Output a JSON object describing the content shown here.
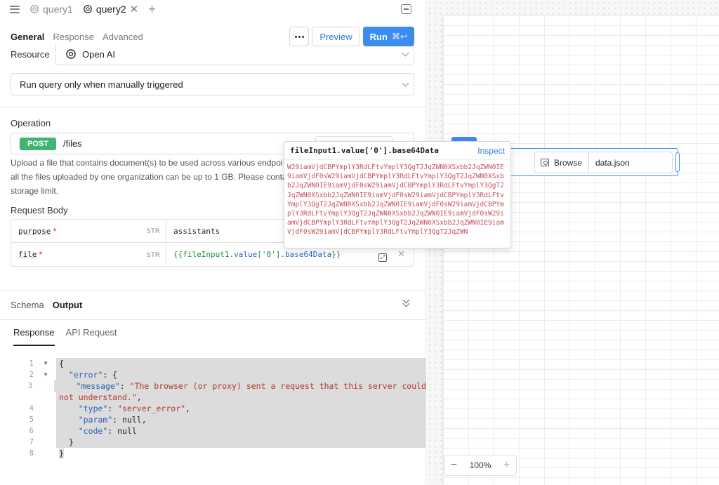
{
  "tabs": {
    "items": [
      {
        "label": "query1",
        "active": false
      },
      {
        "label": "query2",
        "active": true
      }
    ]
  },
  "toolbar": {
    "tabs": [
      "General",
      "Response",
      "Advanced"
    ],
    "preview_label": "Preview",
    "run_label": "Run",
    "run_shortcut": "⌘↩"
  },
  "resource": {
    "label": "Resource",
    "value": "Open AI"
  },
  "trigger": {
    "value": "Run query only when manually triggered"
  },
  "operation": {
    "label": "Operation",
    "method": "POST",
    "path": "/files",
    "description_lines": [
      "Upload a file that contains document(s) to be used across various endpoi",
      "all the files uploaded by one organization can be up to 1 GB. Please conta",
      "storage limit."
    ]
  },
  "request_body": {
    "label": "Request Body",
    "rows": [
      {
        "key": "purpose",
        "type": "STR",
        "value": "assistants"
      },
      {
        "key": "file",
        "type": "STR",
        "value_prefix": "{{fileInput1.",
        "value_prop": "value",
        "value_mid": "['0'].",
        "value_prop2": "base64Data",
        "value_suffix": "}}"
      }
    ]
  },
  "schema_bar": {
    "schema_label": "Schema",
    "output_label": "Output"
  },
  "response_tabs": [
    "Response",
    "API Request"
  ],
  "code_lines": [
    "1",
    "2",
    "3",
    "4",
    "5",
    "6",
    "7",
    "8"
  ],
  "response_json": {
    "error_key": "\"error\"",
    "message_key": "\"message\"",
    "message_val_1": "\"The browser (or proxy) sent a request that this server could",
    "message_val_2": "not understand.\"",
    "type_key": "\"type\"",
    "type_val": "\"server_error\"",
    "param_key": "\"param\"",
    "param_val": "null",
    "code_key": "\"code\"",
    "code_val": "null"
  },
  "popover": {
    "expression": "fileInput1.value['0'].base64Data",
    "inspect_label": "Inspect",
    "value_preview": "W29iamVjdCBPYmplY3RdLFtvYmplY3QgT2JqZWN0XSxbb2JqZWN0IE9iamVjdF0sW29iamVjdCBPYmplY3RdLFtvYmplY3QgT2JqZWN0XSxbb2JqZWN0IE9iamVjdF0sW29iamVjdCBPYmplY3RdLFtvYmplY3QgT2JqZWN0XSxbb2JqZWN0IE9iamVjdF0sW29iamVjdCBPYmplY3RdLFtvYmplY3QgT2JqZWN0XSxbb2JqZWN0IE9iamVjdF0sW29iamVjdCBPYmplY3RdLFtvYmplY3QgT2JqZWN0XSxbb2JqZWN0IE9iamVjdF0sW29iamVjdCBPYmplY3RdLFtvYmplY3QgT2JqZWN0XSxbb2JqZWN0IE9iamVjdF0sW29iamVjdCBPYmplY3RdLFtvYmplY3QgT2JqZWN"
  },
  "canvas": {
    "browse_label": "Browse",
    "file_name": "data.json",
    "zoom_level": "100%"
  },
  "colors": {
    "accent": "#3b8cf0",
    "post_badge": "#3fb56f",
    "popover_value": "#c8505a"
  }
}
